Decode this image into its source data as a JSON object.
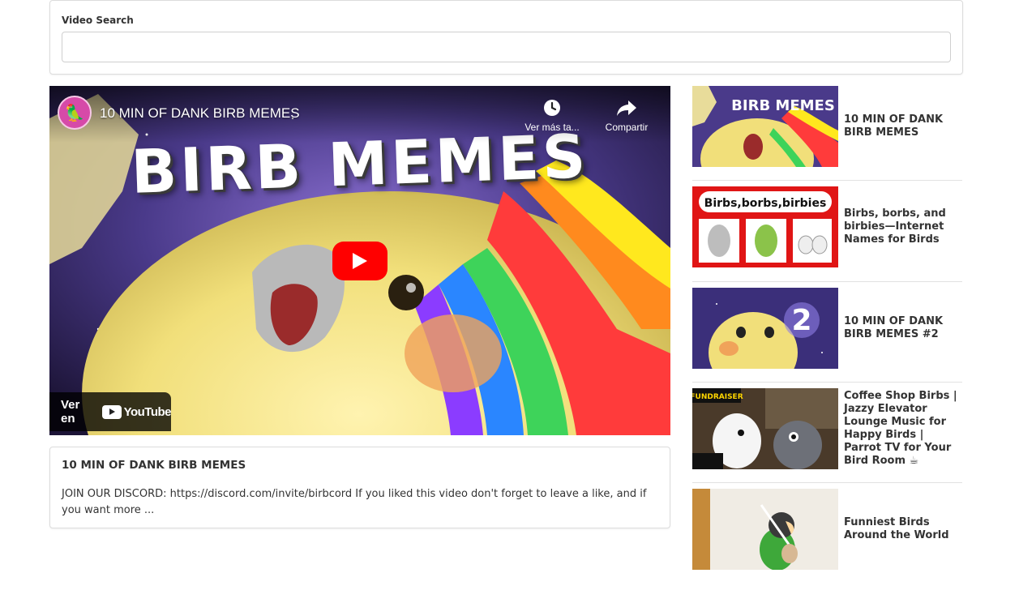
{
  "search": {
    "label": "Video Search",
    "value": "",
    "placeholder": ""
  },
  "player": {
    "title": "10 MIN OF DANK BIRB MEMES",
    "thumbnail_text": "BIRB MEMES",
    "watch_later_label": "Ver más ta...",
    "share_label": "Compartir",
    "watch_on_label": "Ver en",
    "youtube_label": "YouTube",
    "channel_avatar_icon": "parrot-avatar-icon"
  },
  "info": {
    "title": "10 MIN OF DANK BIRB MEMES",
    "description": "JOIN OUR DISCORD: https://discord.com/invite/birbcord If you liked this video don't forget to leave a like, and if you want more ..."
  },
  "sidebar": {
    "items": [
      {
        "label": "10 MIN OF DANK BIRB MEMES",
        "thumb_text": "BIRB MEMES"
      },
      {
        "label": "Birbs, borbs, and birbies—Internet Names for Birds",
        "thumb_text": "Birbs,borbs,birbies"
      },
      {
        "label": "10 MIN OF DANK BIRB MEMES #2",
        "thumb_text": "2"
      },
      {
        "label": "Coffee Shop Birbs | Jazzy Elevator Lounge Music for Happy Birds | Parrot TV for Your Bird Room ☕",
        "thumb_text": "FUNDRAISER"
      },
      {
        "label": "Funniest Birds Around the World",
        "thumb_text": ""
      }
    ]
  },
  "colors": {
    "play_button": "#ff0000",
    "card_border": "#dcdcdc",
    "text": "#333333"
  }
}
